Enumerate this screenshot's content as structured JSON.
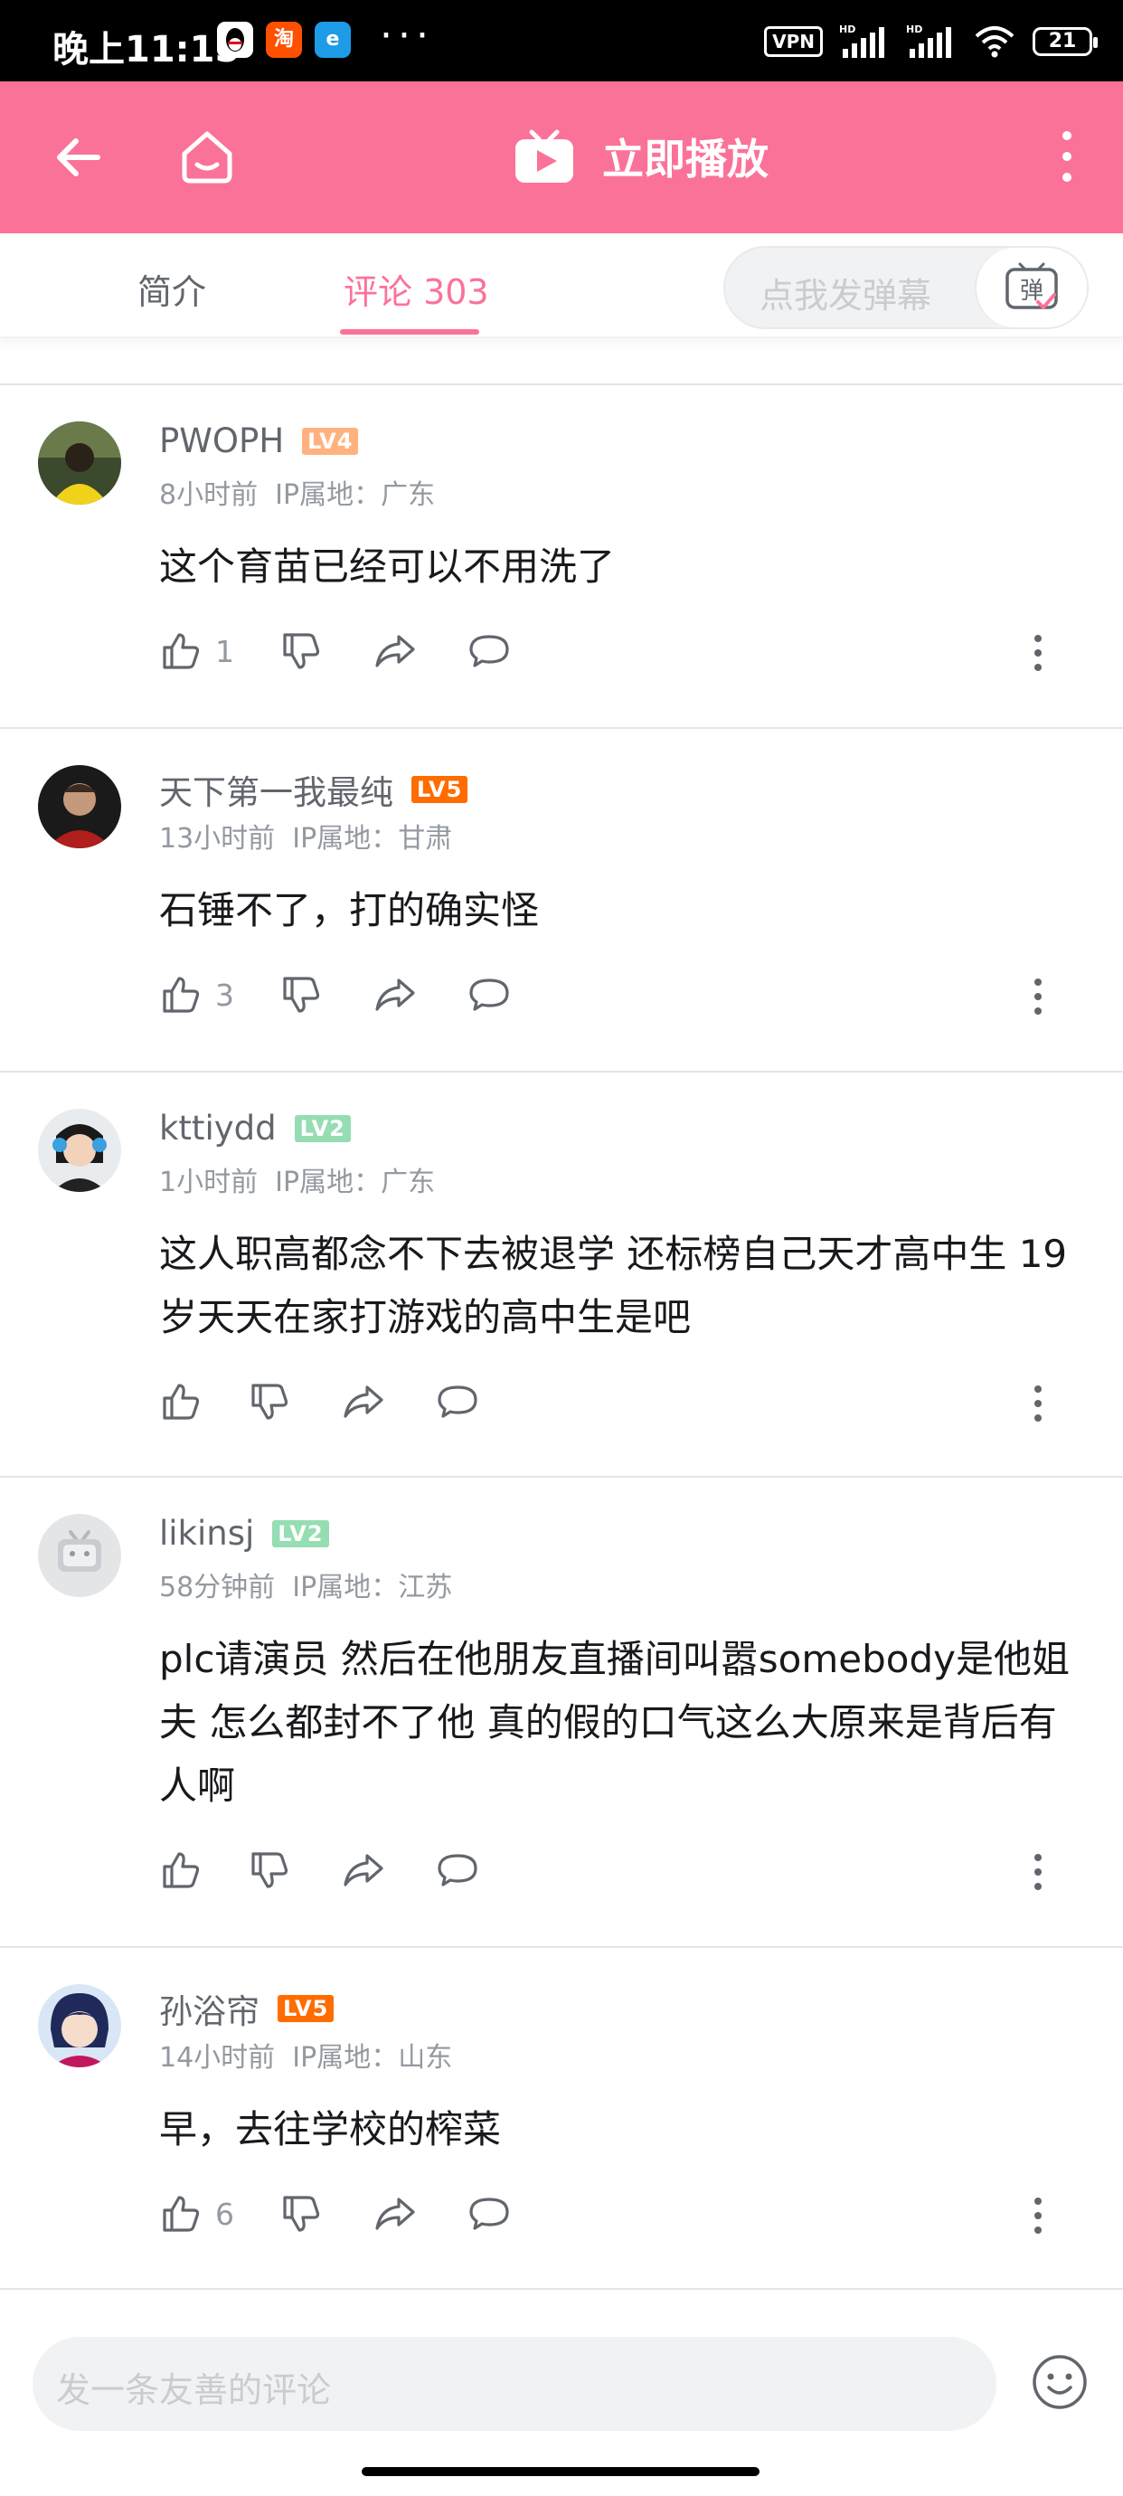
{
  "status_bar": {
    "time": "晚上11:15",
    "dots": "···",
    "vpn": "VPN",
    "battery": "21",
    "apps": [
      {
        "name": "qq-app-icon",
        "color": "#ffffff"
      },
      {
        "name": "taobao-app-icon",
        "label": "淘",
        "color": "#ff5000"
      },
      {
        "name": "blue-app-icon",
        "label": "e",
        "color": "#1e9be6"
      }
    ]
  },
  "top_bar": {
    "title": "立即播放",
    "accent_color": "#fb7299"
  },
  "tabs": {
    "intro": "简介",
    "comments": "评论 303"
  },
  "danmu": {
    "placeholder": "点我发弹幕",
    "icon_label": "弹"
  },
  "comments": [
    {
      "username": "PWOPH",
      "level": "LV4",
      "level_color": "#ffb27f",
      "time": "8小时前",
      "ip": "IP属地：广东",
      "text": "这个育苗已经可以不用洗了",
      "likes": "1"
    },
    {
      "username": "天下第一我最纯",
      "level": "LV5",
      "level_color": "#ff6c00",
      "time": "13小时前",
      "ip": "IP属地：甘肃",
      "text": "石锤不了，打的确实怪",
      "likes": "3"
    },
    {
      "username": "kttiydd",
      "level": "LV2",
      "level_color": "#95ddb2",
      "time": "1小时前",
      "ip": "IP属地：广东",
      "text": "这人职高都念不下去被退学 还标榜自己天才高中生 19岁天天在家打游戏的高中生是吧",
      "likes": ""
    },
    {
      "username": "likinsj",
      "level": "LV2",
      "level_color": "#95ddb2",
      "time": "58分钟前",
      "ip": "IP属地：江苏",
      "text": "plc请演员 然后在他朋友直播间叫嚣somebody是他姐夫 怎么都封不了他 真的假的口气这么大原来是背后有人啊",
      "likes": ""
    },
    {
      "username": "孙浴帘",
      "level": "LV5",
      "level_color": "#ff6c00",
      "time": "14小时前",
      "ip": "IP属地：山东",
      "text": "早，去往学校的榨菜",
      "likes": "6"
    }
  ],
  "bottom": {
    "placeholder": "发一条友善的评论"
  }
}
